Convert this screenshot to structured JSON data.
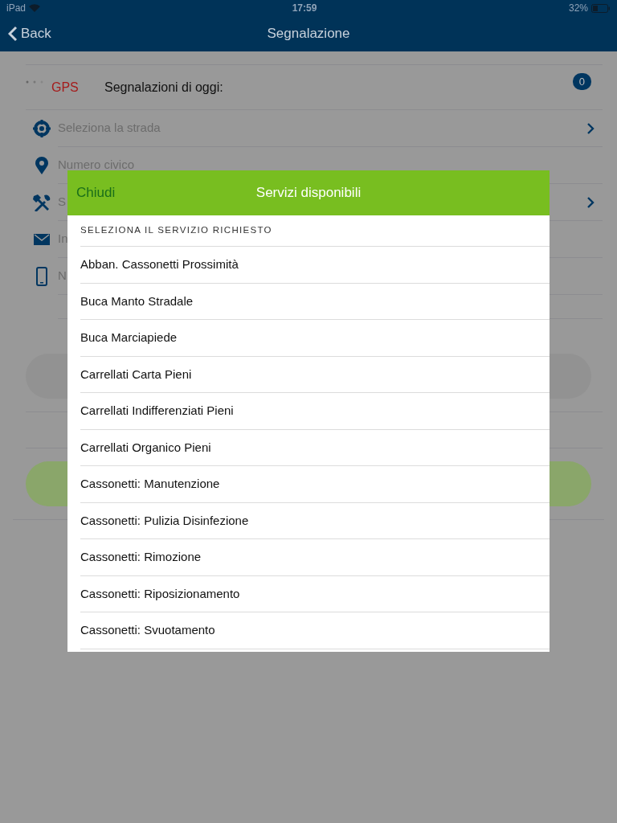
{
  "status_bar": {
    "device": "iPad",
    "time": "17:59",
    "battery": "32%"
  },
  "nav": {
    "back": "Back",
    "title": "Segnalazione"
  },
  "gps": {
    "label": "GPS",
    "counter_label": "Segnalazioni di oggi:",
    "count": "0"
  },
  "fields": [
    {
      "kind": "select",
      "placeholder": "Seleziona la strada"
    },
    {
      "kind": "input",
      "placeholder": "Numero civico"
    },
    {
      "kind": "select",
      "placeholder": "S"
    },
    {
      "kind": "input",
      "placeholder": "In"
    },
    {
      "kind": "input",
      "placeholder": "N"
    }
  ],
  "buttons": [
    {
      "kind": "secondary"
    },
    {
      "kind": "primary"
    }
  ],
  "modal": {
    "close": "Chiudi",
    "title": "Servizi disponibili",
    "section_header": "SELEZIONA IL SERVIZIO RICHIESTO",
    "items": [
      "Abban. Cassonetti Prossimità",
      "Buca Manto Stradale",
      "Buca Marciapiede",
      "Carrellati Carta Pieni",
      "Carrellati Indifferenziati Pieni",
      "Carrellati Organico Pieni",
      "Cassonetti: Manutenzione",
      "Cassonetti: Pulizia Disinfezione",
      "Cassonetti: Rimozione",
      "Cassonetti: Riposizionamento",
      "Cassonetti: Svuotamento"
    ]
  }
}
